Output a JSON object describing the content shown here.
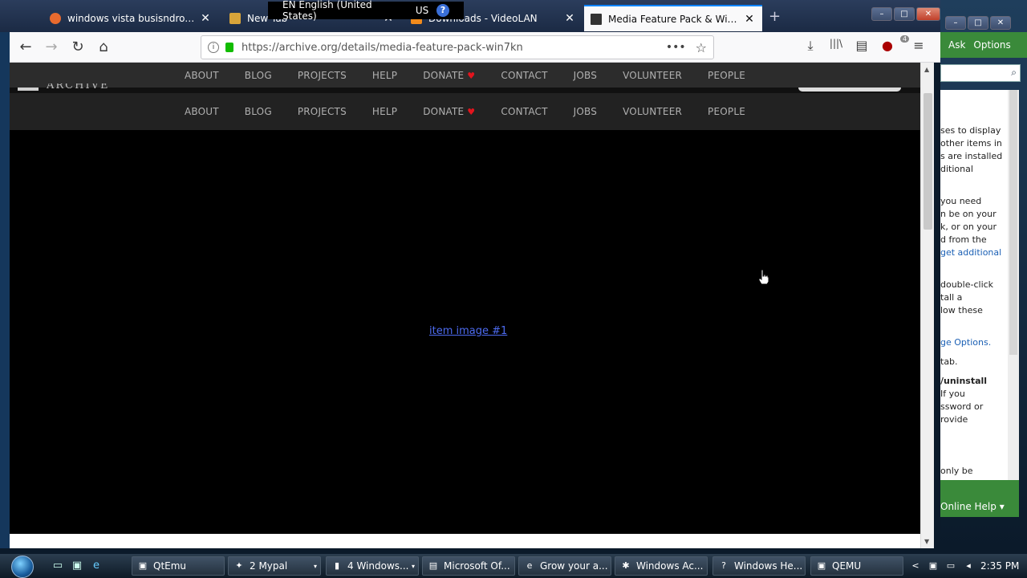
{
  "tabs": [
    {
      "label": "windows vista busisndro.pm/7/",
      "close": "✕"
    },
    {
      "label": "New Tab",
      "close": "✕"
    },
    {
      "label": "Downloads - VideoLAN",
      "close": "✕"
    },
    {
      "label": "Media Feature Pack & Window",
      "close": "✕"
    }
  ],
  "new_tab": "+",
  "window_controls": {
    "minimize": "–",
    "maximize": "□",
    "close": "✕"
  },
  "language_bar": {
    "language": "EN English (United States)",
    "keyboard": "US",
    "help": "?"
  },
  "toolbar": {
    "back": "←",
    "forward": "→",
    "reload": "↻",
    "home": "⌂",
    "url": "https://archive.org/details/media-feature-pack-win7kn",
    "info": "i",
    "page_actions": "•••",
    "bookmark": "☆",
    "download": "⤓",
    "library": "|||\\",
    "sidebar": "▤",
    "addon_badge": "4",
    "menu": "≡"
  },
  "nav": {
    "items": [
      "ABOUT",
      "BLOG",
      "PROJECTS",
      "HELP",
      "DONATE",
      "CONTACT",
      "JOBS",
      "VOLUNTEER",
      "PEOPLE"
    ],
    "heart": "♥"
  },
  "page": {
    "logo_text": "ARCHIVE",
    "item_link": "item image #1"
  },
  "help_window": {
    "ask": "Ask",
    "options": "Options",
    "lines": [
      {
        "text": "ses to display",
        "style": ""
      },
      {
        "text": "other items in",
        "style": ""
      },
      {
        "text": "s are installed",
        "style": ""
      },
      {
        "text": "ditional",
        "style": ""
      },
      {
        "text": "you need",
        "style": ""
      },
      {
        "text": "n be on your",
        "style": ""
      },
      {
        "text": "k, or on your",
        "style": ""
      },
      {
        "text": "d from the",
        "style": ""
      },
      {
        "text": "get additional",
        "style": "link"
      },
      {
        "text": " double-click",
        "style": ""
      },
      {
        "text": "tall a",
        "style": ""
      },
      {
        "text": "low these",
        "style": ""
      },
      {
        "text": "ge Options.",
        "style": "link"
      },
      {
        "text": "tab.",
        "style": ""
      },
      {
        "text": "/uninstall",
        "style": "bold"
      },
      {
        "text": "If you",
        "style": ""
      },
      {
        "text": "ssword or",
        "style": ""
      },
      {
        "text": "rovide",
        "style": ""
      },
      {
        "text": "only be",
        "style": ""
      }
    ],
    "online_help": "Online Help ▾"
  },
  "taskbar": {
    "items": [
      {
        "label": "QtEmu",
        "icon": "▣",
        "dropdown": ""
      },
      {
        "label": "2 Mypal",
        "icon": "✦",
        "dropdown": "▾"
      },
      {
        "label": "4 Windows...",
        "icon": "▮",
        "dropdown": "▾"
      },
      {
        "label": "Microsoft Of...",
        "icon": "▤",
        "dropdown": ""
      },
      {
        "label": "Grow your a...",
        "icon": "e",
        "dropdown": ""
      },
      {
        "label": "Windows Ac...",
        "icon": "✱",
        "dropdown": ""
      },
      {
        "label": "Windows He...",
        "icon": "?",
        "dropdown": ""
      },
      {
        "label": "QEMU",
        "icon": "▣",
        "dropdown": ""
      }
    ],
    "clock": "2:35 PM",
    "tray_arrow": "<"
  },
  "colors": {
    "accent": "#0a84ff",
    "link": "#4d6bf0",
    "heart": "#e3141d",
    "help_green": "#3a8a3a"
  }
}
